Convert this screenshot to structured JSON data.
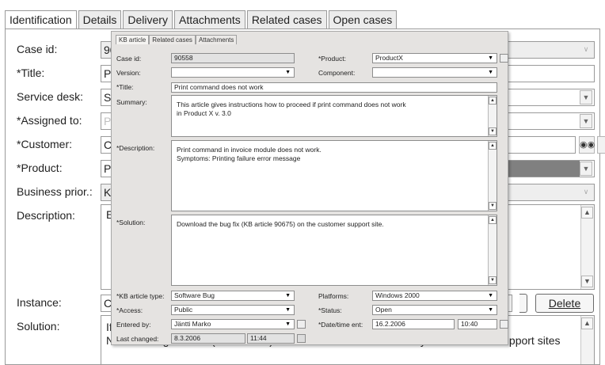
{
  "main": {
    "tabs": [
      "Identification",
      "Details",
      "Delivery",
      "Attachments",
      "Related cases",
      "Open cases"
    ],
    "labels": {
      "case_id": "Case id:",
      "title": "*Title:",
      "service_desk": "Service desk:",
      "assigned_to": "*Assigned to:",
      "customer": "*Customer:",
      "product": "*Product:",
      "business_priority": "Business prior.:",
      "description": "Description:",
      "instance": "Instance:",
      "solution": "Solution:"
    },
    "values": {
      "case_id": "90",
      "title": "Pri",
      "service_desk": "SD",
      "assigned_to": "PS",
      "customer": "Cu",
      "product": "Pro",
      "business_priority": "Ko",
      "description": "Er",
      "instance": "Cu",
      "solution_line1": "If i",
      "solution_line2": "New Printing module (version 2.3) will be available 24th February on Customer Support sites"
    },
    "buttons": {
      "delete": "Delete"
    }
  },
  "dialog": {
    "tabs": [
      "KB article",
      "Related cases",
      "Attachments"
    ],
    "labels": {
      "case_id": "Case id:",
      "product": "*Product:",
      "version": "Version:",
      "component": "Component:",
      "title": "*Title:",
      "summary": "Summary:",
      "description": "*Description:",
      "solution": "*Solution:",
      "kb_article_type": "*KB article type:",
      "platforms": "Platforms:",
      "access": "*Access:",
      "status": "*Status:",
      "entered_by": "Entered by:",
      "datetime_ent": "*Date/time ent:",
      "last_changed": "Last changed:"
    },
    "values": {
      "case_id": "90558",
      "product": "ProductX",
      "version": "",
      "component": "",
      "title": "Print command does not work",
      "summary_line1": "This article gives instructions how to proceed if print command does not work",
      "summary_line2": "in Product X v. 3.0",
      "description_line1": "Print command in invoice module does not work.",
      "description_line2": "Symptoms: Printing failure error message",
      "solution": "Download the bug fix (KB article 90675) on the customer support site.",
      "kb_article_type": "Software Bug",
      "platforms": "Windows 2000",
      "access": "Public",
      "status": "Open",
      "entered_by": "Jäntti Marko",
      "date_ent": "16.2.2006",
      "time_ent": "10:40",
      "last_changed_date": "8.3.2006",
      "last_changed_time": "11:44"
    }
  },
  "colors": {
    "dialog_bg": "#e5e3e1",
    "gray_field": "#808080",
    "border": "#9a9a9a"
  }
}
